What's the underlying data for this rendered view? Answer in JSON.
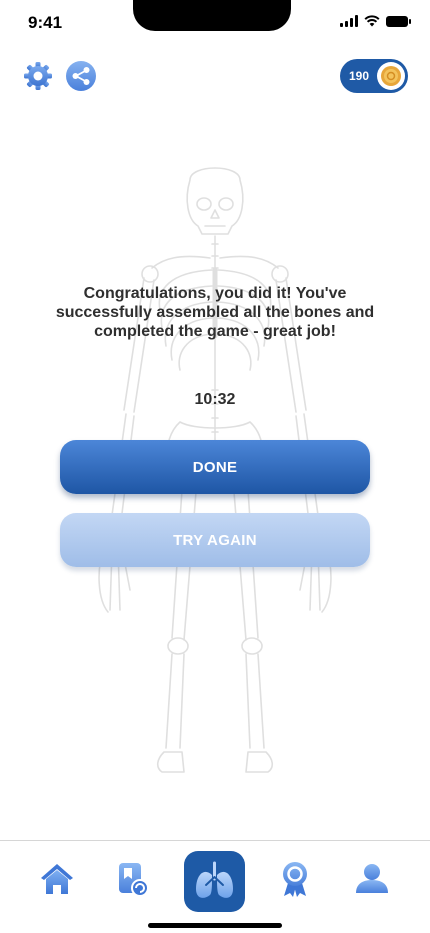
{
  "status_bar": {
    "time": "9:41"
  },
  "header": {
    "settings_icon": "gear-icon",
    "share_icon": "share-icon",
    "coins": {
      "value": "190",
      "icon": "coin-icon"
    }
  },
  "background": {
    "image": "skeleton-illustration"
  },
  "result": {
    "message": "Congratulations, you did it! You've successfully assembled all the bones and completed the game - great job!",
    "timer": "10:32"
  },
  "actions": {
    "done_label": "DONE",
    "try_again_label": "TRY AGAIN"
  },
  "bottom_nav": {
    "items": [
      {
        "icon": "home-icon",
        "active": false
      },
      {
        "icon": "study-cards-icon",
        "active": false
      },
      {
        "icon": "lungs-icon",
        "active": true
      },
      {
        "icon": "award-icon",
        "active": false
      },
      {
        "icon": "profile-icon",
        "active": false
      }
    ]
  },
  "colors": {
    "primary": "#1e56a5",
    "primary_light": "#a8c4ec",
    "icon_blue": "#5a8fe0"
  }
}
